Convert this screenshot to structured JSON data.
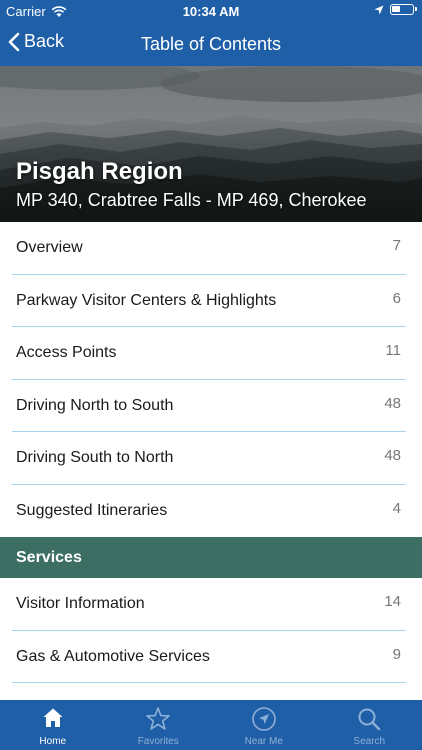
{
  "status_bar": {
    "carrier": "Carrier",
    "time": "10:34 AM"
  },
  "nav": {
    "back_label": "Back",
    "title": "Table of Contents"
  },
  "hero": {
    "title": "Pisgah Region",
    "subtitle": "MP 340, Crabtree Falls - MP 469, Cherokee"
  },
  "items": [
    {
      "label": "Overview",
      "count": "7"
    },
    {
      "label": "Parkway Visitor Centers & Highlights",
      "count": "6"
    },
    {
      "label": "Access Points",
      "count": "11"
    },
    {
      "label": "Driving North to South",
      "count": "48"
    },
    {
      "label": "Driving South to North",
      "count": "48"
    },
    {
      "label": "Suggested Itineraries",
      "count": "4"
    }
  ],
  "services_header": "Services",
  "service_items": [
    {
      "label": "Visitor Information",
      "count": "14"
    },
    {
      "label": "Gas & Automotive Services",
      "count": "9"
    }
  ],
  "tabs": [
    {
      "label": "Home",
      "icon": "home-icon",
      "active": true
    },
    {
      "label": "Favorites",
      "icon": "star-icon"
    },
    {
      "label": "Near Me",
      "icon": "location-arrow-icon"
    },
    {
      "label": "Search",
      "icon": "search-icon"
    }
  ],
  "colors": {
    "nav_blue": "#1f5fa8",
    "section_green": "#3d6e63",
    "divider": "#a8d4ee",
    "tab_inactive": "#8fb0d6"
  }
}
